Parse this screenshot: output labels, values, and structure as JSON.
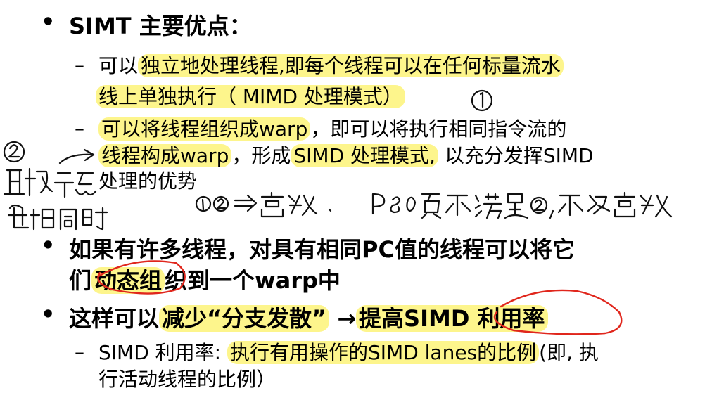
{
  "bullets": {
    "b1": "SIMT 主要优点：",
    "b1_sub1_line1_pre": "可以",
    "b1_sub1_line1_hl": "独立地处理线程,即每个线程可以在任何标量流水",
    "b1_sub1_line2_hl": "线上单独执行（  MIMD 处理模式）",
    "b1_sub2_line1_hl": "可以将线程组织成warp",
    "b1_sub2_line1_post": "，即可以将执行相同指令流的",
    "b1_sub2_line2_hl1": "线程构成warp",
    "b1_sub2_line2_mid": "，形成",
    "b1_sub2_line2_hl2": "SIMD 处理模式,",
    "b1_sub2_line2_post": " 以充分发挥SIMD",
    "b1_sub2_line3": "处理的优势",
    "b2_line1": "如果有许多线程，对具有相同PC值的线程可以将它",
    "b2_line2_pre": "们",
    "b2_line2_hl": "动态组",
    "b2_line2_post": "织到一个warp中",
    "b3_pre": "这样可以",
    "b3_hl1": "减少“分支发散”",
    "b3_arrow": " →",
    "b3_hl2": "提高SIMD 利用率",
    "b3_sub1_pre": "SIMD 利用率: ",
    "b3_sub1_hl": "执行有用操作的SIMD lanes的比例",
    "b3_sub1_post": "(即, 执",
    "b3_sub1_line2": "行活动线程的比例）"
  },
  "markers": {
    "bullet": "•",
    "dash": "–"
  },
  "colors": {
    "highlight": "#fdf58c",
    "red_ink": "#e0261c",
    "ink": "#111111"
  }
}
